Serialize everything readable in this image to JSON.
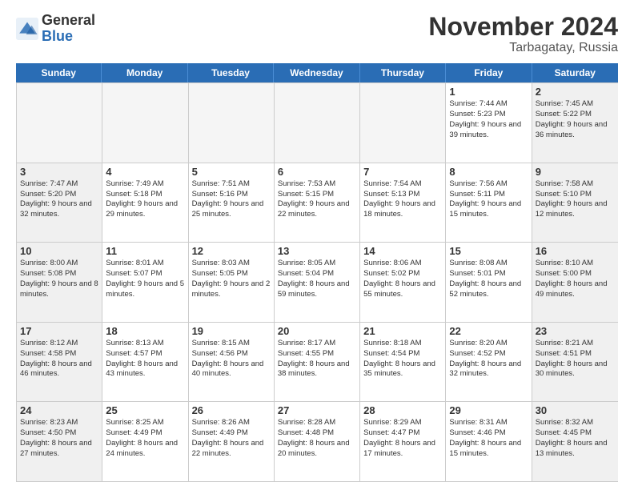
{
  "logo": {
    "general": "General",
    "blue": "Blue"
  },
  "title": "November 2024",
  "location": "Tarbagatay, Russia",
  "header": {
    "days": [
      "Sunday",
      "Monday",
      "Tuesday",
      "Wednesday",
      "Thursday",
      "Friday",
      "Saturday"
    ]
  },
  "weeks": [
    [
      {
        "day": "",
        "empty": true
      },
      {
        "day": "",
        "empty": true
      },
      {
        "day": "",
        "empty": true
      },
      {
        "day": "",
        "empty": true
      },
      {
        "day": "",
        "empty": true
      },
      {
        "day": "1",
        "sunrise": "7:44 AM",
        "sunset": "5:23 PM",
        "daylight": "9 hours and 39 minutes."
      },
      {
        "day": "2",
        "sunrise": "7:45 AM",
        "sunset": "5:22 PM",
        "daylight": "9 hours and 36 minutes."
      }
    ],
    [
      {
        "day": "3",
        "sunrise": "7:47 AM",
        "sunset": "5:20 PM",
        "daylight": "9 hours and 32 minutes."
      },
      {
        "day": "4",
        "sunrise": "7:49 AM",
        "sunset": "5:18 PM",
        "daylight": "9 hours and 29 minutes."
      },
      {
        "day": "5",
        "sunrise": "7:51 AM",
        "sunset": "5:16 PM",
        "daylight": "9 hours and 25 minutes."
      },
      {
        "day": "6",
        "sunrise": "7:53 AM",
        "sunset": "5:15 PM",
        "daylight": "9 hours and 22 minutes."
      },
      {
        "day": "7",
        "sunrise": "7:54 AM",
        "sunset": "5:13 PM",
        "daylight": "9 hours and 18 minutes."
      },
      {
        "day": "8",
        "sunrise": "7:56 AM",
        "sunset": "5:11 PM",
        "daylight": "9 hours and 15 minutes."
      },
      {
        "day": "9",
        "sunrise": "7:58 AM",
        "sunset": "5:10 PM",
        "daylight": "9 hours and 12 minutes."
      }
    ],
    [
      {
        "day": "10",
        "sunrise": "8:00 AM",
        "sunset": "5:08 PM",
        "daylight": "9 hours and 8 minutes."
      },
      {
        "day": "11",
        "sunrise": "8:01 AM",
        "sunset": "5:07 PM",
        "daylight": "9 hours and 5 minutes."
      },
      {
        "day": "12",
        "sunrise": "8:03 AM",
        "sunset": "5:05 PM",
        "daylight": "9 hours and 2 minutes."
      },
      {
        "day": "13",
        "sunrise": "8:05 AM",
        "sunset": "5:04 PM",
        "daylight": "8 hours and 59 minutes."
      },
      {
        "day": "14",
        "sunrise": "8:06 AM",
        "sunset": "5:02 PM",
        "daylight": "8 hours and 55 minutes."
      },
      {
        "day": "15",
        "sunrise": "8:08 AM",
        "sunset": "5:01 PM",
        "daylight": "8 hours and 52 minutes."
      },
      {
        "day": "16",
        "sunrise": "8:10 AM",
        "sunset": "5:00 PM",
        "daylight": "8 hours and 49 minutes."
      }
    ],
    [
      {
        "day": "17",
        "sunrise": "8:12 AM",
        "sunset": "4:58 PM",
        "daylight": "8 hours and 46 minutes."
      },
      {
        "day": "18",
        "sunrise": "8:13 AM",
        "sunset": "4:57 PM",
        "daylight": "8 hours and 43 minutes."
      },
      {
        "day": "19",
        "sunrise": "8:15 AM",
        "sunset": "4:56 PM",
        "daylight": "8 hours and 40 minutes."
      },
      {
        "day": "20",
        "sunrise": "8:17 AM",
        "sunset": "4:55 PM",
        "daylight": "8 hours and 38 minutes."
      },
      {
        "day": "21",
        "sunrise": "8:18 AM",
        "sunset": "4:54 PM",
        "daylight": "8 hours and 35 minutes."
      },
      {
        "day": "22",
        "sunrise": "8:20 AM",
        "sunset": "4:52 PM",
        "daylight": "8 hours and 32 minutes."
      },
      {
        "day": "23",
        "sunrise": "8:21 AM",
        "sunset": "4:51 PM",
        "daylight": "8 hours and 30 minutes."
      }
    ],
    [
      {
        "day": "24",
        "sunrise": "8:23 AM",
        "sunset": "4:50 PM",
        "daylight": "8 hours and 27 minutes."
      },
      {
        "day": "25",
        "sunrise": "8:25 AM",
        "sunset": "4:49 PM",
        "daylight": "8 hours and 24 minutes."
      },
      {
        "day": "26",
        "sunrise": "8:26 AM",
        "sunset": "4:49 PM",
        "daylight": "8 hours and 22 minutes."
      },
      {
        "day": "27",
        "sunrise": "8:28 AM",
        "sunset": "4:48 PM",
        "daylight": "8 hours and 20 minutes."
      },
      {
        "day": "28",
        "sunrise": "8:29 AM",
        "sunset": "4:47 PM",
        "daylight": "8 hours and 17 minutes."
      },
      {
        "day": "29",
        "sunrise": "8:31 AM",
        "sunset": "4:46 PM",
        "daylight": "8 hours and 15 minutes."
      },
      {
        "day": "30",
        "sunrise": "8:32 AM",
        "sunset": "4:45 PM",
        "daylight": "8 hours and 13 minutes."
      }
    ]
  ]
}
